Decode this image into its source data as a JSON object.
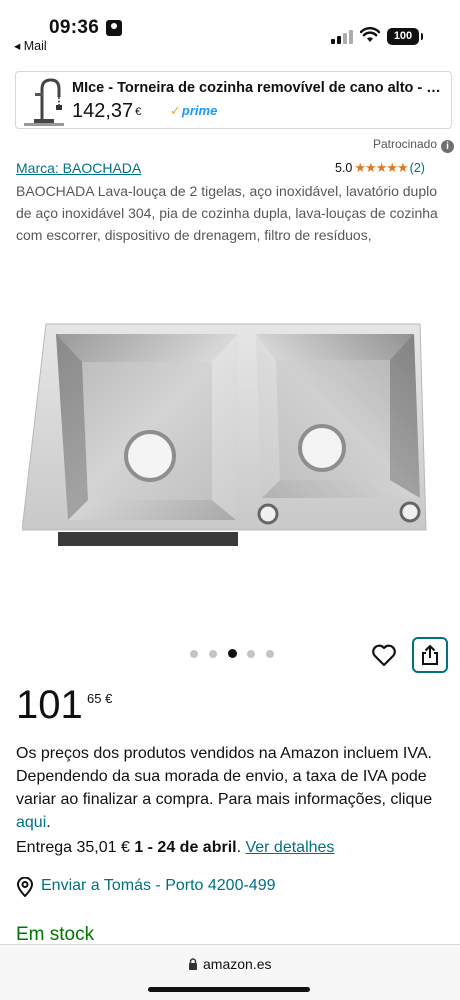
{
  "status_bar": {
    "time": "09:36",
    "back_app": "◂ Mail",
    "battery": "100"
  },
  "sponsored_banner": {
    "title": "MIce - Torneira de cozinha removível de cano alto - Torneira de cozinha",
    "price": "142,37",
    "currency": "€",
    "prime_label": "prime",
    "prime_check": "✓"
  },
  "sponsored_label": "Patrocinado",
  "info_icon": "i",
  "brand_link": "Marca: BAOCHADA",
  "rating": {
    "value": "5.0",
    "stars": "★★★★★",
    "count": "(2)"
  },
  "description": "BAOCHADA Lava-louça de 2 tigelas, aço inoxidável, lavatório duplo de aço inoxidável 304, pia de cozinha dupla, lava-louças de cozinha com escorrer, dispositivo de drenagem, filtro de resíduos,",
  "carousel": {
    "total": 5,
    "active_index": 2
  },
  "price": {
    "whole": "101",
    "fraction": "65 €"
  },
  "vat_notice": {
    "text": "Os preços dos produtos vendidos na Amazon incluem IVA. Dependendo da sua morada de envio, a taxa de IVA pode variar ao finalizar a compra. Para mais informações, clique ",
    "link": "aqui",
    "end": "."
  },
  "delivery": {
    "prefix": "Entrega 35,01 € ",
    "dates": "1 - 24 de abril",
    "sep": ". ",
    "details_link": "Ver detalhes"
  },
  "ship_to": "Enviar a Tomás - Porto 4200-499",
  "stock": "Em stock",
  "url_bar": {
    "domain": "amazon.es"
  },
  "colors": {
    "link": "#007185",
    "stars": "#de7921",
    "stock": "#007600",
    "prime": "#1a98ff"
  }
}
